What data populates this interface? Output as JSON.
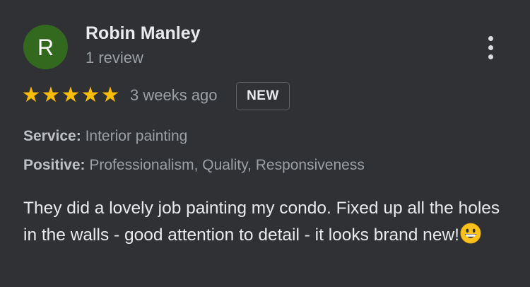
{
  "reviewer": {
    "initial": "R",
    "name": "Robin Manley",
    "review_count": "1 review",
    "avatar_color": "#33691e"
  },
  "rating": {
    "stars": 5,
    "max_stars": 5,
    "star_color": "#fbbc04"
  },
  "date": "3 weeks ago",
  "badge": "NEW",
  "attributes": {
    "service_label": "Service:",
    "service_value": "Interior painting",
    "positive_label": "Positive:",
    "positive_value": "Professionalism, Quality, Responsiveness"
  },
  "review": {
    "text": "They did a lovely job painting my condo. Fixed up all the holes in the walls - good attention to detail - it looks brand new!",
    "emoji": "grinning-face-icon"
  },
  "menu": {
    "icon": "more-vert-icon"
  },
  "colors": {
    "background": "#303134",
    "primary_text": "#e8eaed",
    "secondary_text": "#9aa0a6"
  }
}
